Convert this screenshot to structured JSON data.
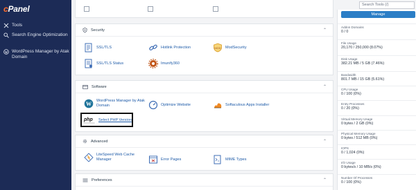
{
  "brand": {
    "prefix": "c",
    "name": "Panel"
  },
  "sidebar": {
    "items": [
      {
        "label": "Tools",
        "icon": "tools-icon"
      },
      {
        "label": "Search Engine Optimization",
        "icon": "search-icon"
      },
      {
        "label": "WordPress Manager by Atak Domain",
        "icon": "wordpress-icon"
      }
    ]
  },
  "search": {
    "placeholder": "Search Tools (/)"
  },
  "sections": {
    "security": {
      "title": "Security",
      "tools": [
        "SSL/TLS",
        "Hotlink Protection",
        "ModSecurity",
        "SSL/TLS Status",
        "Imunify360"
      ]
    },
    "software": {
      "title": "Software",
      "tools": [
        "WordPress Manager by Atak Domain",
        "Optimize Website",
        "Softaculous Apps Installer",
        "Select PHP Version"
      ]
    },
    "advanced": {
      "title": "Advanced",
      "tools": [
        "LiteSpeed Web Cache Manager",
        "Error Pages",
        "MIME Types"
      ]
    },
    "preferences": {
      "title": "Preferences"
    }
  },
  "stats": {
    "manage_label": "Manage",
    "items": [
      {
        "label": "Addon Domains",
        "value": "0 / 0"
      },
      {
        "label": "File Usage",
        "value": "20,170 / 250,000   (8.07%)"
      },
      {
        "label": "Disk Usage",
        "value": "382.21 MB / 5 GB   (7.46%)"
      },
      {
        "label": "Bandwidth",
        "value": "801.7 MB / 15 GB   (5.61%)"
      },
      {
        "label": "CPU Usage",
        "value": "0 / 100   (0%)"
      },
      {
        "label": "Entry Processes",
        "value": "0 / 20   (0%)"
      },
      {
        "label": "Virtual Memory Usage",
        "value": "0 bytes / 2 GB   (0%)"
      },
      {
        "label": "Physical Memory Usage",
        "value": "0 bytes / 512 MB   (0%)"
      },
      {
        "label": "IOPS",
        "value": "0 / 1,024   (0%)"
      },
      {
        "label": "I/O Usage",
        "value": "0 bytes/s / 10 MB/s   (0%)"
      },
      {
        "label": "Number Of Processes",
        "value": "0 / 100   (0%)"
      }
    ]
  }
}
